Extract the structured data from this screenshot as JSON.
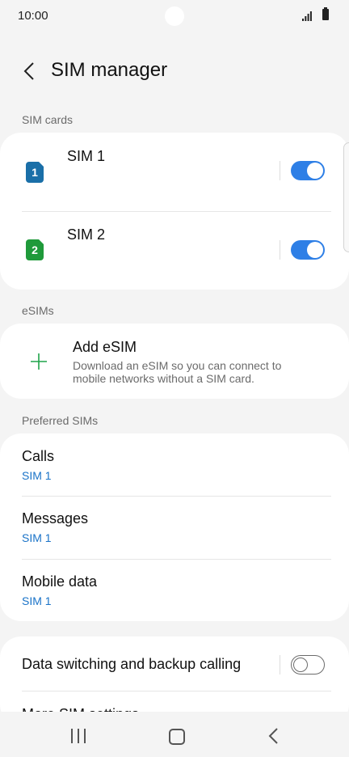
{
  "status_bar": {
    "time": "10:00"
  },
  "header": {
    "title": "SIM manager"
  },
  "sim_cards": {
    "section_label": "SIM cards",
    "items": [
      {
        "number": "1",
        "name": "SIM 1",
        "enabled": true,
        "color": "#1a6fa8"
      },
      {
        "number": "2",
        "name": "SIM 2",
        "enabled": true,
        "color": "#1f9a3a"
      }
    ]
  },
  "esims": {
    "section_label": "eSIMs",
    "add_title": "Add eSIM",
    "add_description": "Download an eSIM so you can connect to mobile networks without a SIM card.",
    "accent": "#1fa34a"
  },
  "preferred": {
    "section_label": "Preferred SIMs",
    "items": [
      {
        "title": "Calls",
        "value": "SIM 1"
      },
      {
        "title": "Messages",
        "value": "SIM 1"
      },
      {
        "title": "Mobile data",
        "value": "SIM 1"
      }
    ]
  },
  "other": {
    "data_switching_label": "Data switching and backup calling",
    "data_switching_enabled": false,
    "more_label": "More SIM settings"
  },
  "colors": {
    "accent": "#2e7fe6",
    "link": "#1a73c8"
  }
}
